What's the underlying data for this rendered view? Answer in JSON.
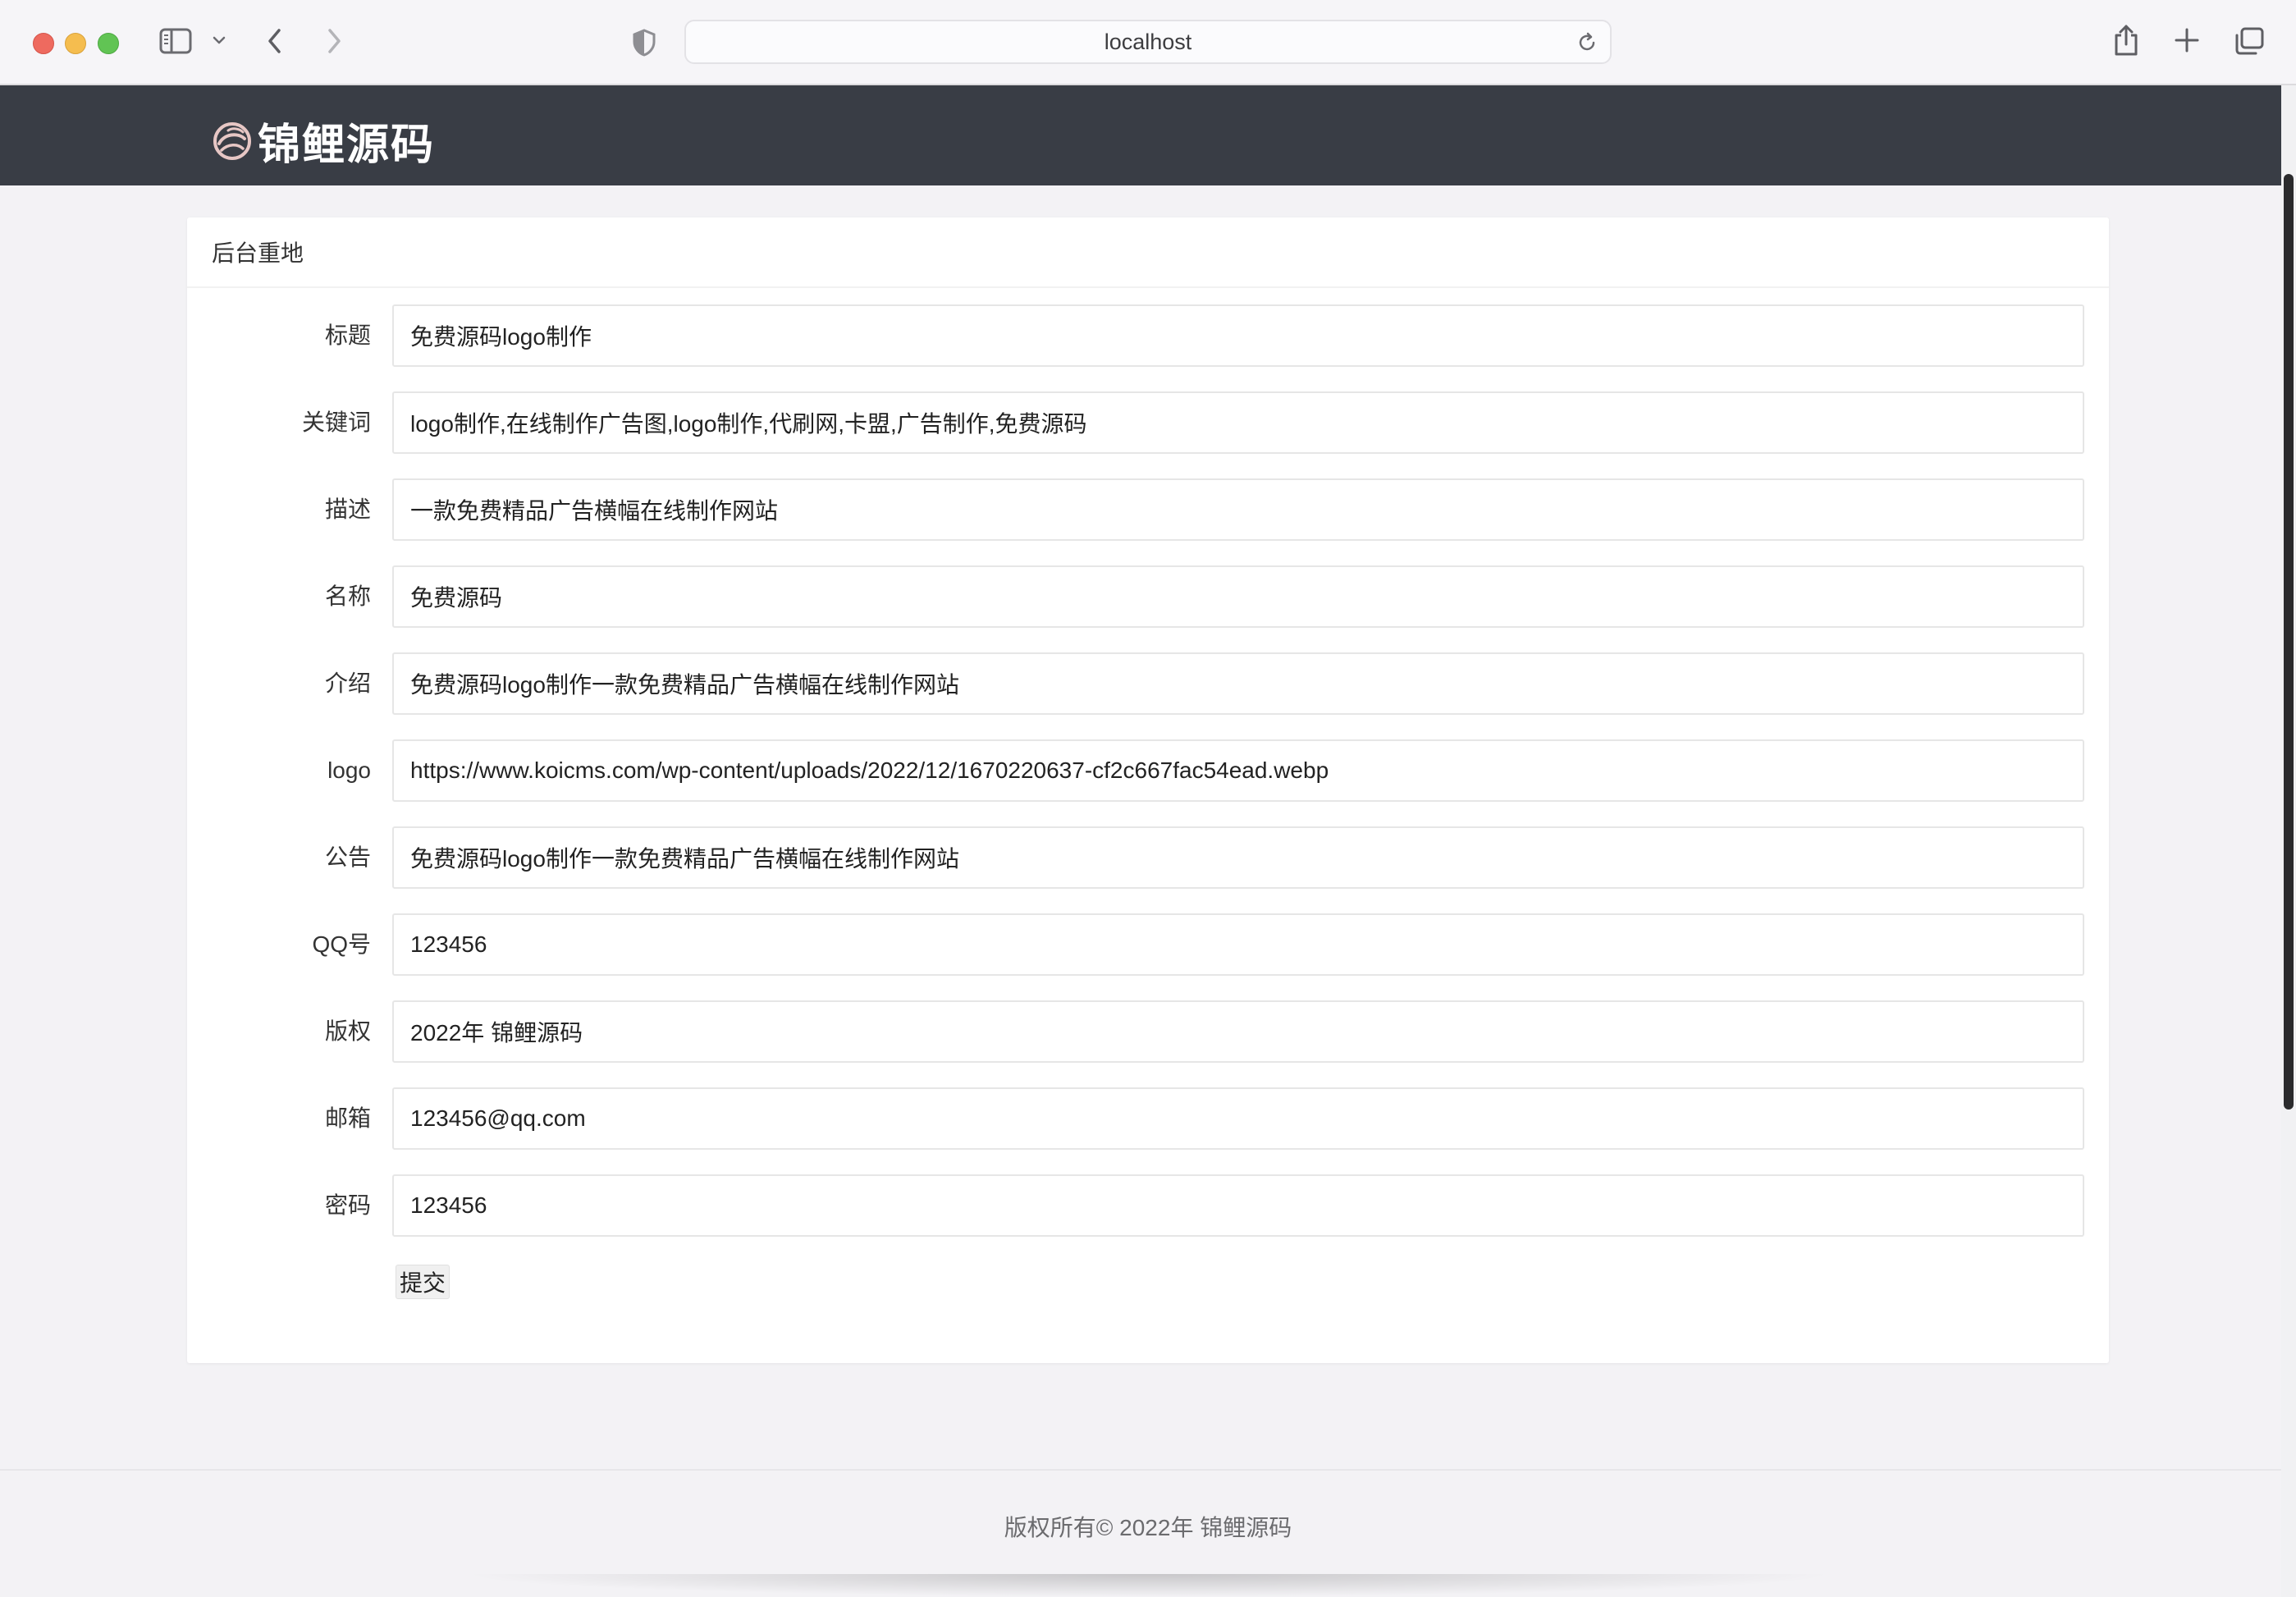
{
  "browser": {
    "url": "localhost",
    "icons": [
      "sidebar-toggle-icon",
      "chevron-down-icon",
      "back-arrow-icon",
      "forward-arrow-icon",
      "shield-icon",
      "reload-icon",
      "share-icon",
      "new-tab-plus-icon",
      "tabs-overview-icon"
    ]
  },
  "header": {
    "brand_name": "锦鲤源码",
    "background": "#393d45"
  },
  "panel": {
    "title": "后台重地"
  },
  "form": {
    "fields": [
      {
        "label": "标题",
        "value": "免费源码logo制作"
      },
      {
        "label": "关键词",
        "value": "logo制作,在线制作广告图,logo制作,代刷网,卡盟,广告制作,免费源码"
      },
      {
        "label": "描述",
        "value": "一款免费精品广告横幅在线制作网站"
      },
      {
        "label": "名称",
        "value": "免费源码"
      },
      {
        "label": "介绍",
        "value": "免费源码logo制作一款免费精品广告横幅在线制作网站"
      },
      {
        "label": "logo",
        "value": "https://www.koicms.com/wp-content/uploads/2022/12/1670220637-cf2c667fac54ead.webp"
      },
      {
        "label": "公告",
        "value": "免费源码logo制作一款免费精品广告横幅在线制作网站"
      },
      {
        "label": "QQ号",
        "value": "123456"
      },
      {
        "label": "版权",
        "value": "2022年 锦鲤源码"
      },
      {
        "label": "邮箱",
        "value": "123456@qq.com"
      },
      {
        "label": "密码",
        "value": "123456"
      }
    ],
    "submit_label": "提交"
  },
  "footer": {
    "text": "版权所有© 2022年 锦鲤源码"
  }
}
